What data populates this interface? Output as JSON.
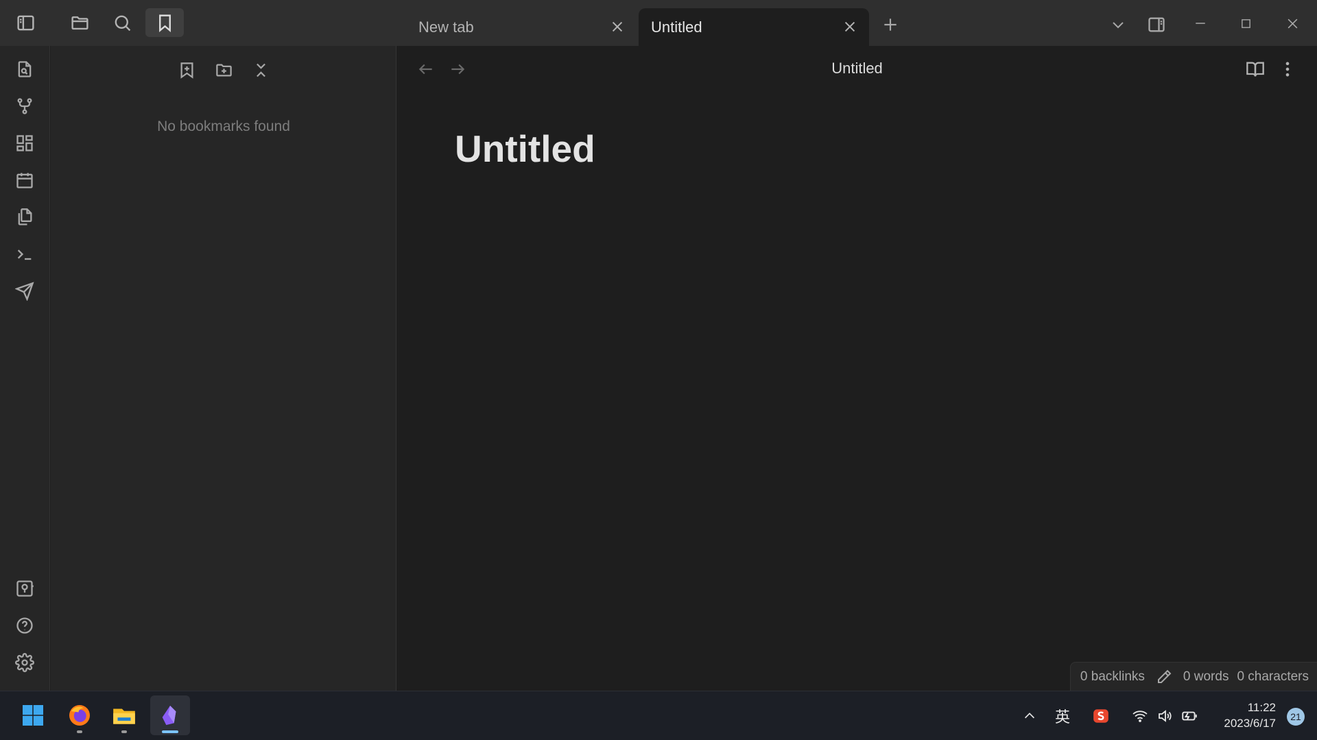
{
  "titlebar": {
    "tabs": [
      {
        "label": "New tab",
        "active": false
      },
      {
        "label": "Untitled",
        "active": true
      }
    ]
  },
  "sidepanel": {
    "empty_message": "No bookmarks found"
  },
  "editor": {
    "view_title": "Untitled",
    "inline_title": "Untitled"
  },
  "statusbar": {
    "backlinks": "0 backlinks",
    "words": "0 words",
    "characters": "0 characters"
  },
  "taskbar": {
    "ime": "英",
    "time": "11:22",
    "date": "2023/6/17",
    "notifications": "21"
  },
  "colors": {
    "accent": "#8a5cf5",
    "background": "#1e1e1e",
    "panel": "#262626"
  }
}
